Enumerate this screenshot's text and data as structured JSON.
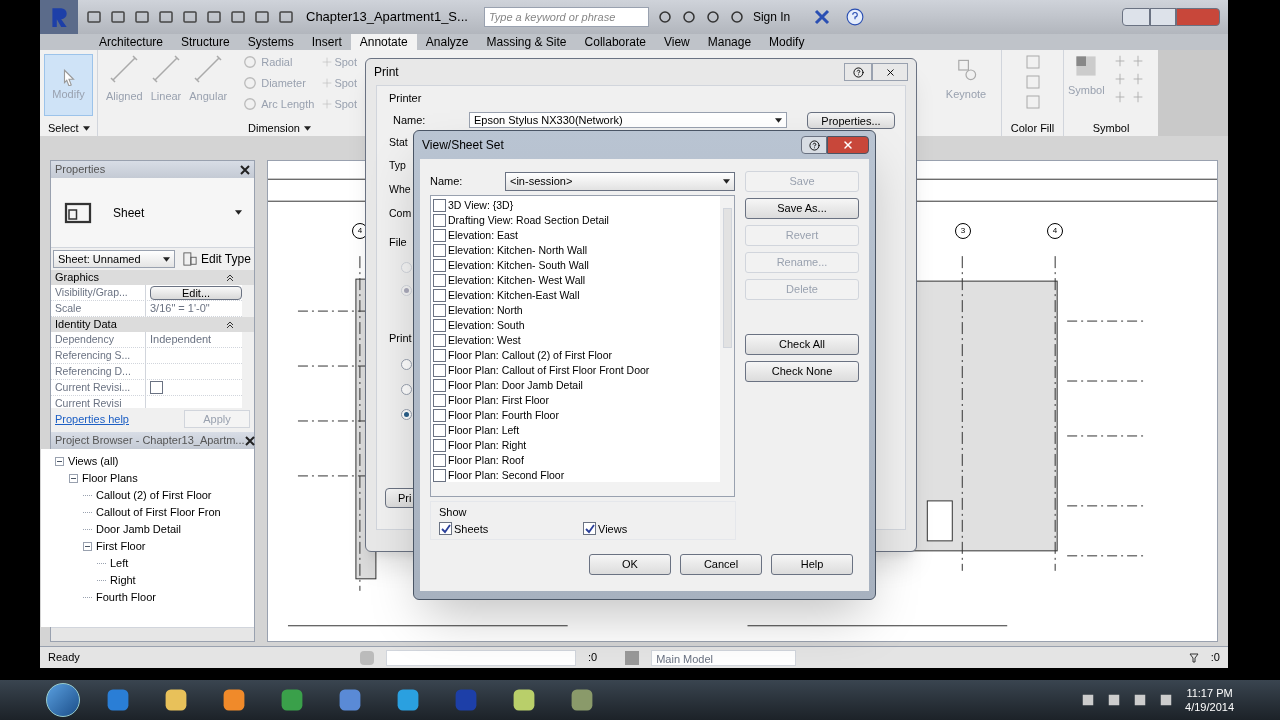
{
  "app_title": "Chapter13_Apartment1_S...",
  "search": {
    "placeholder": "Type a keyword or phrase"
  },
  "sign_in": "Sign In",
  "ribbon_tabs": [
    {
      "label": "Architecture",
      "selected": false
    },
    {
      "label": "Structure",
      "selected": false
    },
    {
      "label": "Systems",
      "selected": false
    },
    {
      "label": "Insert",
      "selected": false
    },
    {
      "label": "Annotate",
      "selected": true
    },
    {
      "label": "Analyze",
      "selected": false
    },
    {
      "label": "Massing & Site",
      "selected": false
    },
    {
      "label": "Collaborate",
      "selected": false
    },
    {
      "label": "View",
      "selected": false
    },
    {
      "label": "Manage",
      "selected": false
    },
    {
      "label": "Modify",
      "selected": false
    }
  ],
  "select_panel": {
    "tool": {
      "label": "Modify",
      "selected": true
    },
    "label": "Select"
  },
  "dimension_panel": {
    "large_tools": [
      "Aligned",
      "Linear",
      "Angular"
    ],
    "small_tools": [
      "Radial",
      "Diameter",
      "Arc Length"
    ],
    "spot_tools": [
      "Spot",
      "Spot",
      "Spot"
    ],
    "label": "Dimension"
  },
  "keynote": "Keynote",
  "color_fill_panel": {
    "label": "Color Fill"
  },
  "symbol_panel": {
    "tool": "Symbol",
    "label": "Symbol"
  },
  "properties": {
    "title": "Properties",
    "type": "Sheet",
    "selector": "Sheet: Unnamed",
    "edit_type": "Edit Type",
    "groups": [
      {
        "name": "Graphics",
        "rows": [
          {
            "kind": "button",
            "label": "Visibility/Grap...",
            "value": "Edit..."
          },
          {
            "kind": "text",
            "label": "Scale",
            "value": "3/16\" = 1'-0\""
          }
        ]
      },
      {
        "name": "Identity Data",
        "rows": [
          {
            "kind": "text",
            "label": "Dependency",
            "value": "Independent"
          },
          {
            "kind": "text",
            "label": "Referencing S...",
            "value": ""
          },
          {
            "kind": "text",
            "label": "Referencing D...",
            "value": ""
          },
          {
            "kind": "checkbox",
            "label": "Current Revisi...",
            "checked": false
          },
          {
            "kind": "text",
            "label": "Current Revisi",
            "value": ""
          }
        ]
      }
    ],
    "help": "Properties help",
    "apply": "Apply"
  },
  "project_browser": {
    "title": "Project Browser - Chapter13_Apartm...",
    "tree": [
      {
        "label": "Views (all)",
        "expanded": true,
        "children": [
          {
            "label": "Floor Plans",
            "expanded": true,
            "children": [
              {
                "label": "Callout (2) of First Floor"
              },
              {
                "label": "Callout of First Floor Fron"
              },
              {
                "label": "Door Jamb Detail"
              },
              {
                "label": "First Floor",
                "expanded": true,
                "children": [
                  {
                    "label": "Left"
                  },
                  {
                    "label": "Right"
                  }
                ]
              },
              {
                "label": "Fourth Floor"
              }
            ]
          }
        ]
      }
    ]
  },
  "grid_bubbles": [
    "4",
    "3",
    "4"
  ],
  "print_dialog": {
    "title": "Print",
    "printer_group": "Printer",
    "name_label": "Name:",
    "printer": "Epson Stylus NX330(Network)",
    "properties_button": "Properties...",
    "cut_labels": [
      "Stat",
      "Typ",
      "Whe",
      "Com"
    ],
    "file_group": "File",
    "file_options": [
      {
        "selected": false
      },
      {
        "selected": true
      }
    ],
    "print_range_group": "Print",
    "range_options": [
      {
        "selected": false
      },
      {
        "selected": false
      },
      {
        "selected": true
      }
    ],
    "print_button": "Pri"
  },
  "view_sheet_dialog": {
    "title": "View/Sheet Set",
    "name_label": "Name:",
    "name_value": "<in-session>",
    "side_buttons": [
      {
        "label": "Save",
        "disabled": true
      },
      {
        "label": "Save As...",
        "disabled": false
      },
      {
        "label": "Revert",
        "disabled": true
      },
      {
        "label": "Rename...",
        "disabled": true
      },
      {
        "label": "Delete",
        "disabled": true
      }
    ],
    "check_buttons": [
      "Check All",
      "Check None"
    ],
    "items": [
      {
        "label": "3D View: {3D}",
        "checked": false
      },
      {
        "label": "Drafting View: Road Section Detail",
        "checked": false
      },
      {
        "label": "Elevation: East",
        "checked": false
      },
      {
        "label": "Elevation: Kitchen- North Wall",
        "checked": false
      },
      {
        "label": "Elevation: Kitchen- South Wall",
        "checked": false
      },
      {
        "label": "Elevation: Kitchen- West Wall",
        "checked": false
      },
      {
        "label": "Elevation: Kitchen-East Wall",
        "checked": false
      },
      {
        "label": "Elevation: North",
        "checked": false
      },
      {
        "label": "Elevation: South",
        "checked": false
      },
      {
        "label": "Elevation: West",
        "checked": false
      },
      {
        "label": "Floor Plan: Callout (2) of First Floor",
        "checked": false
      },
      {
        "label": "Floor Plan: Callout of First Floor Front Door",
        "checked": false
      },
      {
        "label": "Floor Plan: Door Jamb Detail",
        "checked": false
      },
      {
        "label": "Floor Plan: First Floor",
        "checked": false
      },
      {
        "label": "Floor Plan: Fourth Floor",
        "checked": false
      },
      {
        "label": "Floor Plan: Left",
        "checked": false
      },
      {
        "label": "Floor Plan: Right",
        "checked": false
      },
      {
        "label": "Floor Plan: Roof",
        "checked": false
      },
      {
        "label": "Floor Plan: Second Floor",
        "checked": false
      }
    ],
    "show_label": "Show",
    "show_options": [
      {
        "label": "Sheets",
        "checked": true
      },
      {
        "label": "Views",
        "checked": true
      }
    ],
    "footer_buttons": [
      "OK",
      "Cancel",
      "Help"
    ]
  },
  "status_bar": {
    "text": "Ready",
    "selection_count": ":0",
    "model": "Main Model",
    "filter_count": ":0"
  },
  "taskbar": {
    "time": "11:17 PM",
    "date": "4/19/2014"
  }
}
